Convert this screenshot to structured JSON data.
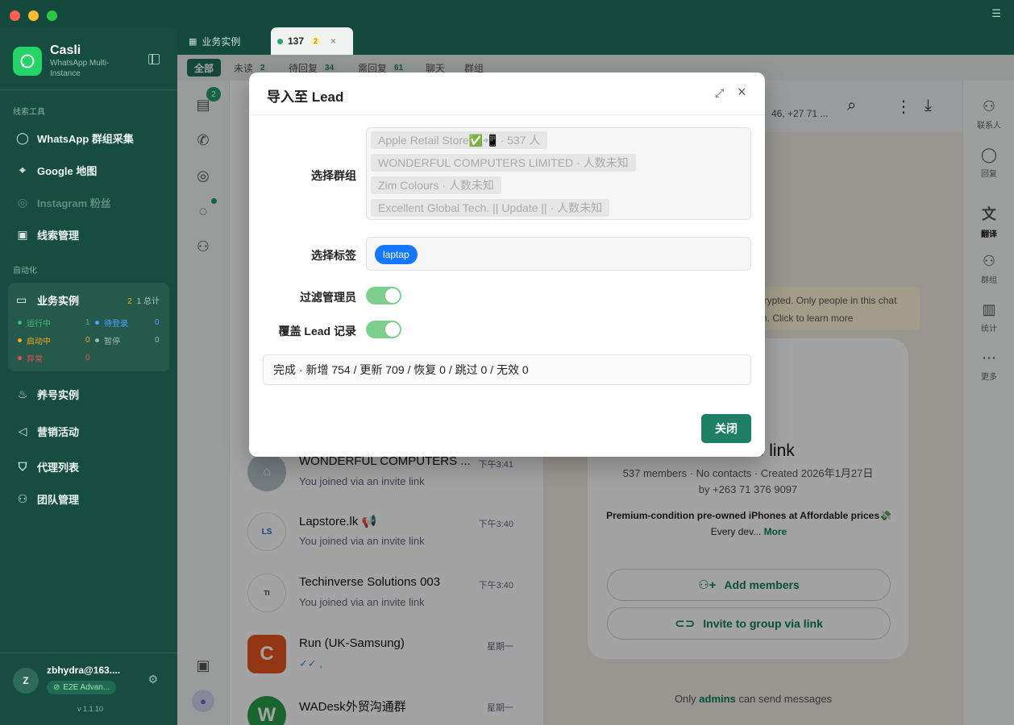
{
  "app": {
    "name": "Casli",
    "subtitle": "WhatsApp Multi-Instance",
    "version": "v 1.1.10"
  },
  "sidebar": {
    "section_leads": "线索工具",
    "section_auto": "自动化",
    "items": {
      "group_collect": "WhatsApp 群组采集",
      "google_map": "Google 地图",
      "instagram": "Instagram 粉丝",
      "lead_manage": "线索管理",
      "nurture": "养号实例",
      "marketing": "营销活动",
      "proxy": "代理列表",
      "team": "团队管理"
    },
    "instance_card": {
      "title": "业务实例",
      "count": "2",
      "total": "1 总计",
      "running_label": "运行中",
      "running_val": "1",
      "pending_label": "待登录",
      "pending_val": "0",
      "starting_label": "启动中",
      "starting_val": "0",
      "paused_label": "暂停",
      "paused_val": "0",
      "error_label": "异常",
      "error_val": "0"
    },
    "user": {
      "initial": "Z",
      "email": "zbhydra@163....",
      "badge": "E2E Advan..."
    }
  },
  "tabs": {
    "biz": "业务实例",
    "active": "137",
    "active_badge": "2",
    "close": "×"
  },
  "filters": {
    "all": "全部",
    "unread": "未读",
    "unread_count": "2",
    "pending": "待回复",
    "pending_count": "34",
    "need_reply": "需回复",
    "need_reply_count": "61",
    "chat": "聊天",
    "group": "群组"
  },
  "rail": {
    "badge": "2"
  },
  "chats": [
    {
      "name": "WONDERFUL COMPUTERS ...",
      "time": "下午3:41",
      "msg": "You joined via an invite link"
    },
    {
      "name": "Lapstore.lk 📢",
      "time": "下午3:40",
      "msg": "You joined via an invite link"
    },
    {
      "name": "Techinverse Solutions 003",
      "time": "下午3:40",
      "msg": "You joined via an invite link"
    },
    {
      "name": "Run (UK-Samsung)",
      "time": "星期一",
      "msg": "✓✓ ,"
    },
    {
      "name": "WADesk外贸沟通群",
      "time": "星期一",
      "msg": ""
    }
  ],
  "chat_pane": {
    "header_numbers": "46, +27 71 ...",
    "e2e_note": "ncrypted. Only people in this chat em. Click to learn more",
    "info_title": "an invite link",
    "info_meta_1": "537 members · No contacts · Created 2026年1月27日",
    "info_meta_2": "by +263 71 376 9097",
    "info_desc": "Premium-condition pre-owned iPhones at Affordable prices💸",
    "info_desc_2": "Every dev...",
    "more": "More",
    "add_members": "Add members",
    "invite_link": "Invite to group via link",
    "admins_prefix": "Only",
    "admins_word": "admins",
    "admins_suffix": "can send messages"
  },
  "rightbar": {
    "contact": "联系人",
    "reply": "回复",
    "translate": "翻译",
    "group": "群组",
    "stats": "统计",
    "more": "更多"
  },
  "modal": {
    "title": "导入至 Lead",
    "label_groups": "选择群组",
    "groups": [
      "Apple Retail Store✅📲 · 537 人",
      "WONDERFUL COMPUTERS LIMITED · 人数未知",
      "Zim Colours · 人数未知",
      "Excellent Global Tech. || Update || · 人数未知"
    ],
    "label_tags": "选择标签",
    "tag": "laptap",
    "label_filter_admin": "过滤管理员",
    "label_overwrite": "覆盖 Lead 记录",
    "result": "完成 · 新增 754 / 更新 709 / 恢复 0 / 跳过 0 / 无效 0",
    "close_button": "关闭"
  },
  "colors": {
    "brand_green": "#25d366",
    "sidebar_bg": "#174c40",
    "primary_button": "#1e7f64",
    "toggle_on": "#7ccf8d",
    "tag_blue": "#1677ff"
  }
}
